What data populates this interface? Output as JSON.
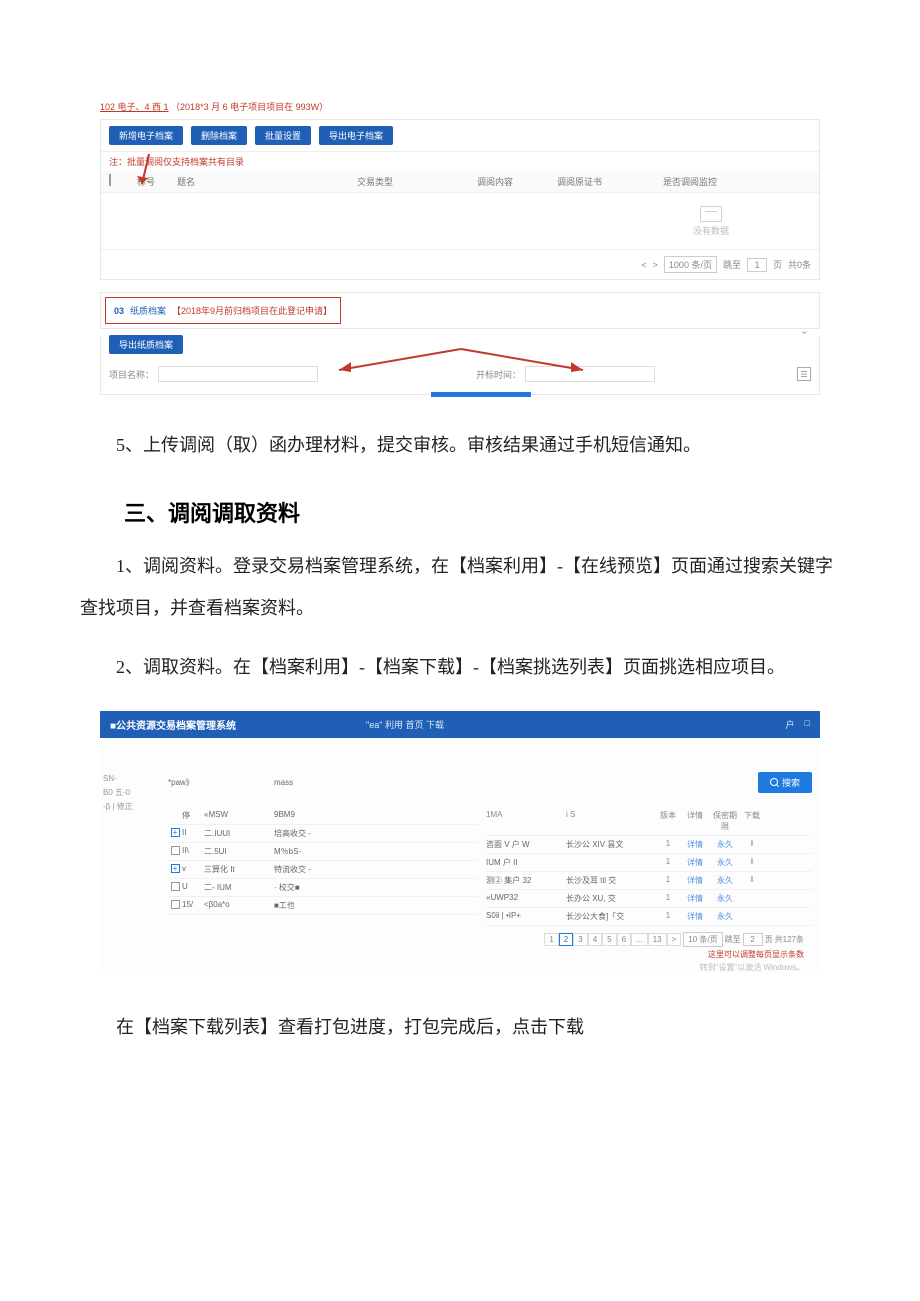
{
  "ss1": {
    "header_link": "102 电子、4 西 1",
    "header_desc": "（2018*3 月 6 电子项目项目在 993W）",
    "toolbar": {
      "btn_new": "新增电子档案",
      "btn_del": "删除档案",
      "btn_batch": "批量设置",
      "btn_export": "导出电子档案"
    },
    "note": "注：批量调阅仅支持档案共有目录",
    "thead": {
      "num": "标号",
      "title": "题名",
      "type": "交易类型",
      "content": "调阅内容",
      "cert": "调阅原证书",
      "mon": "是否调阅监控"
    },
    "empty_text": "没有数据",
    "footer": {
      "pagesize": "1000 条/页",
      "goto": "跳至",
      "page": "1",
      "suffix": "页",
      "total": "共0条"
    },
    "sect3": {
      "num": "03",
      "label": "纸质档案",
      "note": "【2018年9月前归档项目在此登记申请】"
    },
    "export_paper": "导出纸质档案",
    "form": {
      "proj_label": "项目名称：",
      "open_label": "开标时间："
    }
  },
  "para5": "5、上传调阅（取）函办理材料，提交审核。审核结果通过手机短信通知。",
  "heading3": "三、调阅调取资料",
  "para3_1": "1、调阅资料。登录交易档案管理系统，在【档案利用】-【在线预览】页面通过搜索关键字查找项目，并查看档案资料。",
  "para3_2": "2、调取资料。在【档案利用】-【档案下载】-【档案挑选列表】页面挑选相应项目。",
  "ss2": {
    "system_name": "■公共资源交易档案管理系统",
    "breadcrumb": "\"ea\" 利用 首页 下载",
    "header_right_1": "户",
    "header_right_2": "□",
    "sidebar": {
      "l1": "SN-",
      "l2": "B0 五-0",
      "l3": "-β | 修正"
    },
    "search": {
      "label1": "*paw》",
      "label2": "mass",
      "button": "搜索"
    },
    "left_head": {
      "c1": "停",
      "c2": "«MSW",
      "c3": "9BM9"
    },
    "left_rows": [
      {
        "sel": "plus",
        "c1": "II",
        "c2": "二.IUUI",
        "c3": "培高收交 -"
      },
      {
        "sel": "cb",
        "c1": "II\\",
        "c2": "二.5UI",
        "c3": "M％bS-"
      },
      {
        "sel": "plus",
        "c1": "v",
        "c2": "三算化 It",
        "c3": "特流收交 -"
      },
      {
        "sel": "cb",
        "c1": "U",
        "c2": "二- IUM",
        "c3": "· 校交■"
      },
      {
        "sel": "cb",
        "c1": "15/",
        "c2": "<β0a*o",
        "c3": "■工也"
      }
    ],
    "mid_rows": [
      {
        "c0": "1MA",
        "c1": "i S"
      },
      {
        "c0": "咨面 V 户 W",
        "c1": "长沙公 XIV 昙文"
      },
      {
        "c0": "IUM 户  II",
        "c1": ""
      },
      {
        "c0": "测② 集户 32",
        "c1": "长沙及耳 til 交"
      },
      {
        "c0": "«UWP32",
        "c1": "长办公 XU, 交"
      },
      {
        "c0": "S0ⅱ | •IP+",
        "c1": "长沙公大食]「交"
      }
    ],
    "right_head": {
      "c2": "版本",
      "c3": "详情",
      "c4": "保密期限",
      "c5": "下载"
    },
    "right_rows": [
      {
        "c2": "1",
        "c3": "详情",
        "c4": "永久",
        "dl": true
      },
      {
        "c2": "1",
        "c3": "详情",
        "c4": "永久",
        "dl": true
      },
      {
        "c2": "1",
        "c3": "详情",
        "c4": "永久",
        "dl": true
      },
      {
        "c2": "1",
        "c3": "详情",
        "c4": "永久",
        "dl": false
      },
      {
        "c2": "1",
        "c3": "详情",
        "c4": "永久",
        "dl": false
      }
    ],
    "pagination": {
      "pages": [
        "1",
        "2",
        "3",
        "4",
        "5",
        "6",
        "...",
        "13",
        ">"
      ],
      "active": 1,
      "pagesize": "10 条/页",
      "goto": "跳至",
      "pg": "2",
      "suffix": "页",
      "total": "共127条"
    },
    "red_note": "这里可以调整每页显示条数",
    "hint": "转到\"设置\"以激活 Windows。"
  },
  "para_last": "在【档案下载列表】查看打包进度，打包完成后，点击下载"
}
